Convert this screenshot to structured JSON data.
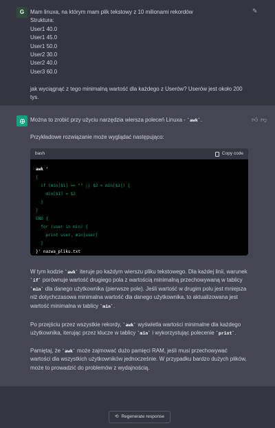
{
  "user": {
    "avatar_letter": "G",
    "message": "Mam linuxa, na którym mam plik tekstowy z 10 milionami rekordów\nStruktura:\nUser1 40.0\nUser1 45.0\nUser1 50.0\nUser2 30.0\nUser2 40.0\nUser3 60.0\n\njak wyciągnąć z tego minimalną wartość dla każdego z Userów? Userów jest około 200 tys."
  },
  "assistant": {
    "intro_prefix": "Można to zrobić przy użyciu narzędzia wiersza poleceń Linuxa - ",
    "intro_code": "`awk`",
    "intro_suffix": ".",
    "example_intro": "Przykładowe rozwiązanie może wyglądać następująco:",
    "code_lang": "bash",
    "copy_label": "Copy code",
    "code_lines": [
      "awk '",
      "{",
      "  if (min[$1] == \"\" || $2 < min[$1]) {",
      "    min[$1] = $2",
      "  }",
      "}",
      "END {",
      "  for (user in min) {",
      "    print user, min[user]",
      "  }",
      "}' nazwa_pliku.txt"
    ],
    "p1_a": "W tym kodzie ",
    "p1_code1": "`awk`",
    "p1_b": " iteruje po każdym wierszu pliku tekstowego. Dla każdej linii, warunek ",
    "p1_code2": "`if`",
    "p1_c": " porównuje wartość drugiego pola z wartością minimalną przechowywaną w tablicy ",
    "p1_code3": "`min`",
    "p1_d": " dla danego użytkownika (pierwsze pole). Jeśli wartość w drugim polu jest mniejsza niż dotychczasowa minimalna wartość dla danego użytkownika, to aktualizowana jest wartość minimalna w tablicy ",
    "p1_code4": "`min`",
    "p1_e": ".",
    "p2_a": "Po przejściu przez wszystkie rekordy, ",
    "p2_code1": "`awk`",
    "p2_b": " wyświetla wartości minimalne dla każdego użytkownika, iterując przez klucze w tablicy ",
    "p2_code2": "`min`",
    "p2_c": " i wykorzystując polecenie ",
    "p2_code3": "`print`",
    "p2_d": ".",
    "p3_a": "Pamiętaj, że ",
    "p3_code1": "`awk`",
    "p3_b": " może zajmować dużo pamięci RAM, jeśli musi przechowywać wartości dla wszystkich użytkowników jednocześnie. W przypadku bardzo dużych plików, może to prowadzić do problemów z wydajnością."
  },
  "regenerate_label": "Regenerate response",
  "icons": {
    "edit": "edit-icon",
    "thumbs_up": "thumbs-up-icon",
    "thumbs_down": "thumbs-down-icon",
    "copy": "copy-icon",
    "regenerate": "refresh-icon",
    "openai": "openai-logo-icon"
  },
  "colors": {
    "background": "#343541",
    "assistant_background": "#444654",
    "accent": "#10a37f",
    "code_background": "#000000",
    "code_keyword": "#00a67d"
  }
}
